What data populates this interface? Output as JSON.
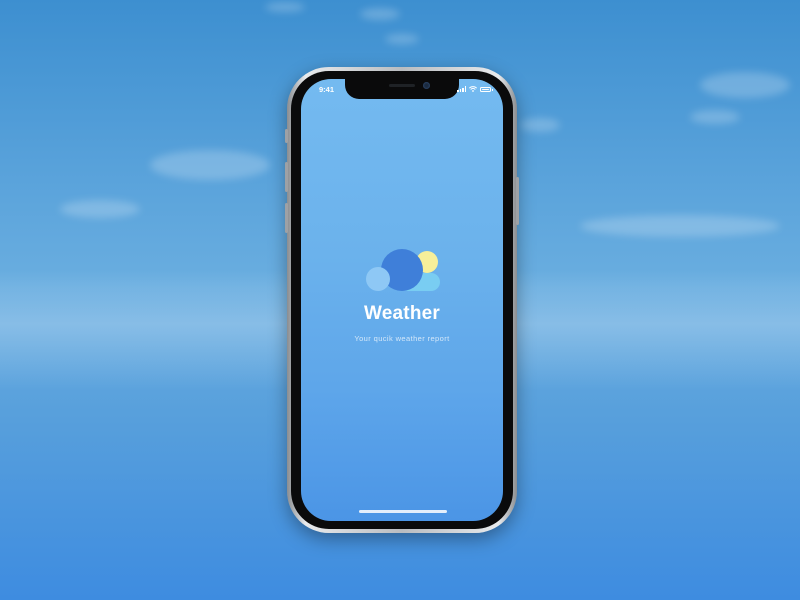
{
  "status_bar": {
    "time": "9:41",
    "icons": [
      "signal-icon",
      "wifi-icon",
      "battery-icon"
    ]
  },
  "splash": {
    "title": "Weather",
    "subtitle": "Your qucik weather report",
    "logo_icon": "weather-logo-icon"
  },
  "colors": {
    "background_top": "#3d8fd0",
    "background_bottom": "#3e8ce0",
    "screen_top": "#74baf0",
    "screen_bottom": "#4b95e6",
    "logo_cloud_dark": "#3f7fd9",
    "logo_cloud_light": "#8ec8f5",
    "logo_sun": "#f6ef9a",
    "logo_cyan": "#79cdf2"
  }
}
